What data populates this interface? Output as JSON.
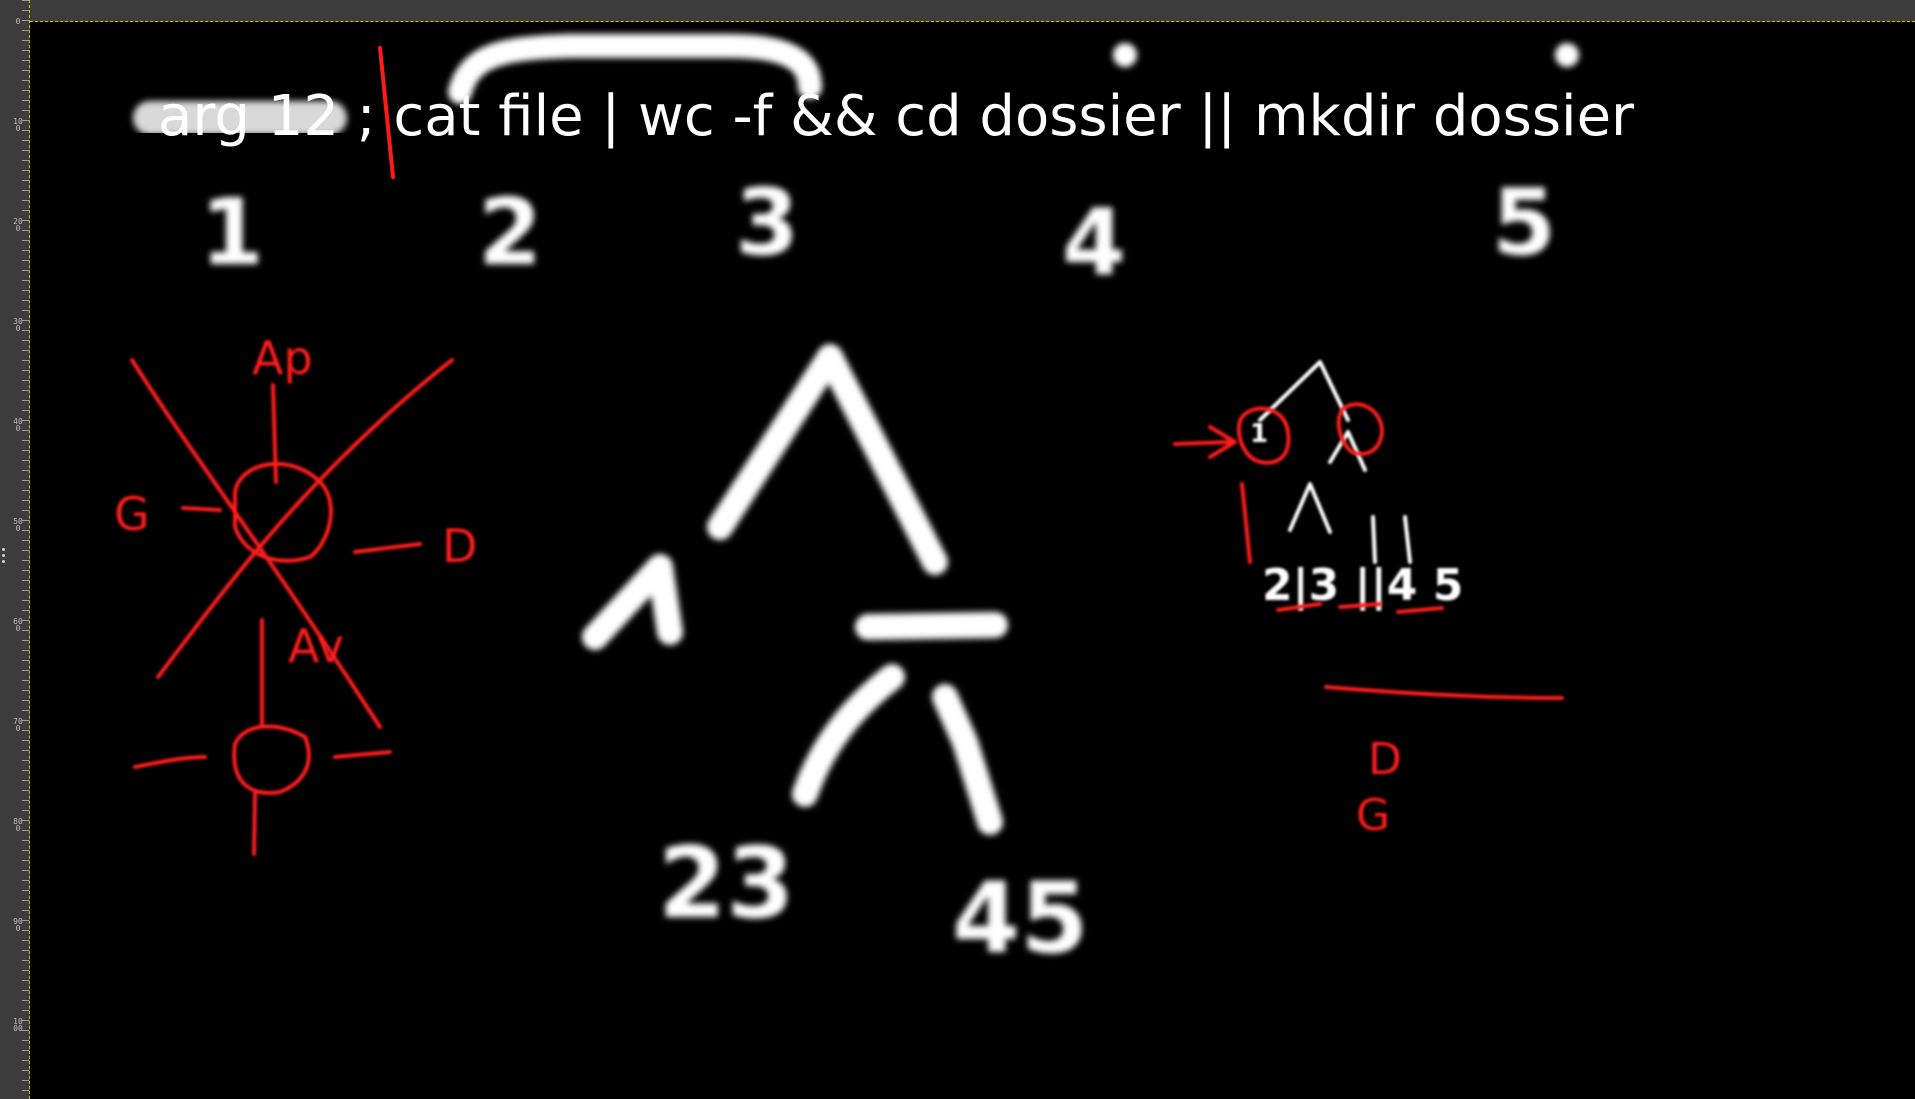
{
  "app": {
    "canvas_background": "#000000",
    "ink_white": "#ffffff",
    "ink_red": "#ff1a1a",
    "ruler_color": "#3c3c3c"
  },
  "ruler": {
    "left_labels": [
      "0",
      "100",
      "200",
      "300",
      "400",
      "500",
      "600",
      "700",
      "800",
      "900",
      "1000"
    ]
  },
  "headline": {
    "text": "arg   12 ; cat file | wc -f && cd dossier || mkdir dossier"
  },
  "numbers_row": [
    "1",
    "2",
    "3",
    "4",
    "5"
  ],
  "big_tree": {
    "leaf_left": "1",
    "leaf_pair_left": "23",
    "leaf_pair_right": "45"
  },
  "small_tree": {
    "root_label": "1",
    "leaves": "2|3 ||4 5"
  },
  "red_diagram": {
    "top_label": "Ap",
    "left_label": "G",
    "right_label": "D",
    "bottom_label": "Av"
  },
  "legend_right": {
    "line1": "D",
    "line2": "G"
  }
}
